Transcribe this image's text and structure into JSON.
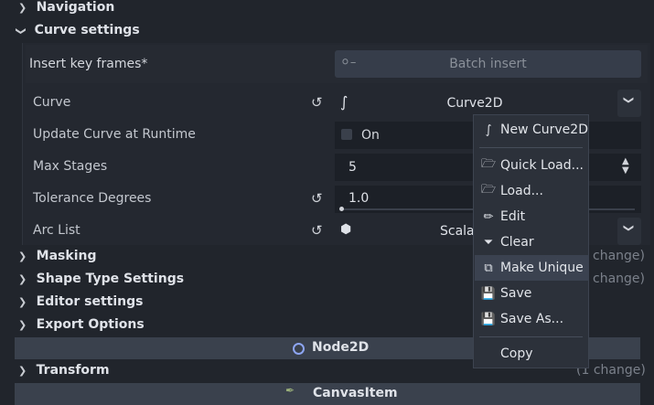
{
  "sections": {
    "navigation": "Navigation",
    "curve_settings": "Curve settings",
    "masking": "Masking",
    "shape_type_settings": "Shape Type Settings",
    "editor_settings": "Editor settings",
    "export_options": "Export Options",
    "transform": "Transform"
  },
  "insert_key_frames": {
    "label": "Insert key frames*",
    "button": "Batch insert"
  },
  "properties": {
    "curve": {
      "label": "Curve",
      "value": "Curve2D"
    },
    "update_curve": {
      "label": "Update Curve at Runtime",
      "value": "On"
    },
    "max_stages": {
      "label": "Max Stages",
      "value": "5"
    },
    "tolerance": {
      "label": "Tolerance Degrees",
      "value": "1.0",
      "fraction": 0.0
    },
    "arc_list": {
      "label": "Arc List",
      "value": "Scalal"
    }
  },
  "change_hints": {
    "masking": "change)",
    "shape_type": "change)",
    "transform": "(1 change)"
  },
  "class_headers": {
    "node2d": "Node2D",
    "canvas_item": "CanvasItem"
  },
  "context_menu": {
    "items": [
      {
        "label": "New Curve2D",
        "icon": "curve-icon"
      },
      {
        "label": "Quick Load...",
        "icon": "folder-icon"
      },
      {
        "label": "Load...",
        "icon": "folder-icon"
      },
      {
        "label": "Edit",
        "icon": "edit-icon"
      },
      {
        "label": "Clear",
        "icon": "clear-icon"
      },
      {
        "label": "Make Unique",
        "icon": "duplicate-icon"
      },
      {
        "label": "Save",
        "icon": "save-icon"
      },
      {
        "label": "Save As...",
        "icon": "save-icon"
      },
      {
        "label": "Copy",
        "icon": ""
      }
    ],
    "highlighted": "Make Unique"
  },
  "colors": {
    "background": "#21252c",
    "menu_bg": "#2c313a",
    "highlight": "#3b4250",
    "node_icon": "#8da5f3"
  }
}
